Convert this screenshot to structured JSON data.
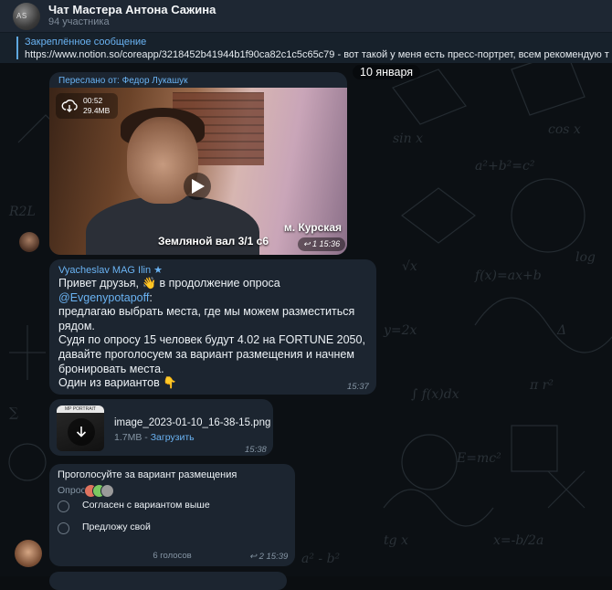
{
  "header": {
    "title": "Чат Мастера Антона Сажина",
    "subtitle": "94 участника",
    "avatar_text": "AS"
  },
  "pinned": {
    "title": "Закреплённое сообщение",
    "text": "https://www.notion.so/coreapp/3218452b41944b1f90ca82c1c5c65c79 - вот такой у меня есть пресс-портрет, всем рекомендую такой"
  },
  "date_pill": "10 января",
  "messages": {
    "video": {
      "forwarded_label": "Переслано от: Федор Лукашук",
      "duration": "00:52",
      "size": "29.4MB",
      "caption_line1": "м. Курская",
      "caption_line2": "Земляной вал 3/1 с6",
      "time": "↩ 1 15:36"
    },
    "text": {
      "sender": "Vyacheslav MAG Ilin",
      "line1_pre": "Привет друзья, ",
      "wave_emoji": "👋",
      "line1_post": " в продолжение опроса",
      "mention": "@Evgenypotapoff",
      "line2_rest": ":",
      "body": "предлагаю выбрать места, где мы можем разместиться рядом.",
      "body2": "Судя по опросу 15 человек будут 4.02 на FORTUNE 2050, давайте проголосуем за вариант размещения и начнем бронировать места.",
      "body3_pre": "Один из вариантов ",
      "point_emoji": "👇",
      "time": "15:37"
    },
    "file": {
      "thumb_label": "MP PORTRAIT",
      "name": "image_2023-01-10_16-38-15.png",
      "size": "1.7MB",
      "separator": " - ",
      "download_label": "Загрузить",
      "time": "15:38"
    },
    "poll": {
      "question": "Проголосуйте за вариант размещения",
      "type_label": "Опрос",
      "options": [
        {
          "label": "Согласен с вариантом выше"
        },
        {
          "label": "Предложу свой"
        }
      ],
      "votes": "6 голосов",
      "time": "↩ 2 15:39",
      "voter_colors": [
        "#e0735f",
        "#7bc862",
        "#9a9a9a"
      ]
    }
  },
  "colors": {
    "accent": "#6ab3f3",
    "bubble": "#1c2530",
    "header": "#1e2733"
  }
}
